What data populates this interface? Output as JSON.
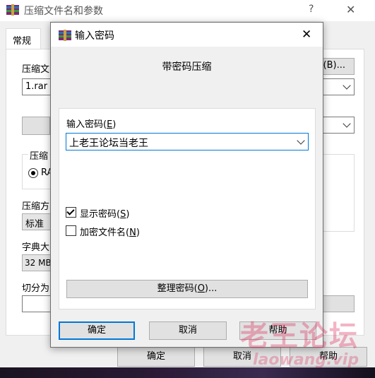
{
  "parent": {
    "title": "压缩文件名和参数",
    "help_glyph": "?",
    "close_glyph": "✕",
    "tab_general": "常规",
    "archive_name_label": "压缩文",
    "archive_name_value": "1.rar",
    "browse_label": "(B)...",
    "format_group_label": "压缩",
    "format_rar_label": "RA",
    "method_label": "压缩方",
    "method_value": "标准",
    "dict_label": "字典大",
    "dict_value": "32 MB",
    "split_label": "切分为",
    "ok_label": "确定",
    "cancel_label": "取消",
    "help_label": "帮助"
  },
  "dialog": {
    "title": "输入密码",
    "heading": "带密码压缩",
    "password_label": "输入密码(",
    "password_label_hotkey": "E",
    "password_label_end": ")",
    "password_value": "上老王论坛当老王",
    "show_password_label": "显示密码(",
    "show_password_hotkey": "S",
    "show_password_end": ")",
    "show_password_checked": true,
    "encrypt_names_label": "加密文件名(",
    "encrypt_names_hotkey": "N",
    "encrypt_names_end": ")",
    "encrypt_names_checked": false,
    "organize_label": "整理密码(",
    "organize_hotkey": "O",
    "organize_end": ")...",
    "ok_label": "确定",
    "cancel_label": "取消",
    "help_label": "帮助",
    "close_glyph": "✕"
  },
  "watermark": {
    "text": "老王论坛",
    "url": "laowang.vip"
  }
}
